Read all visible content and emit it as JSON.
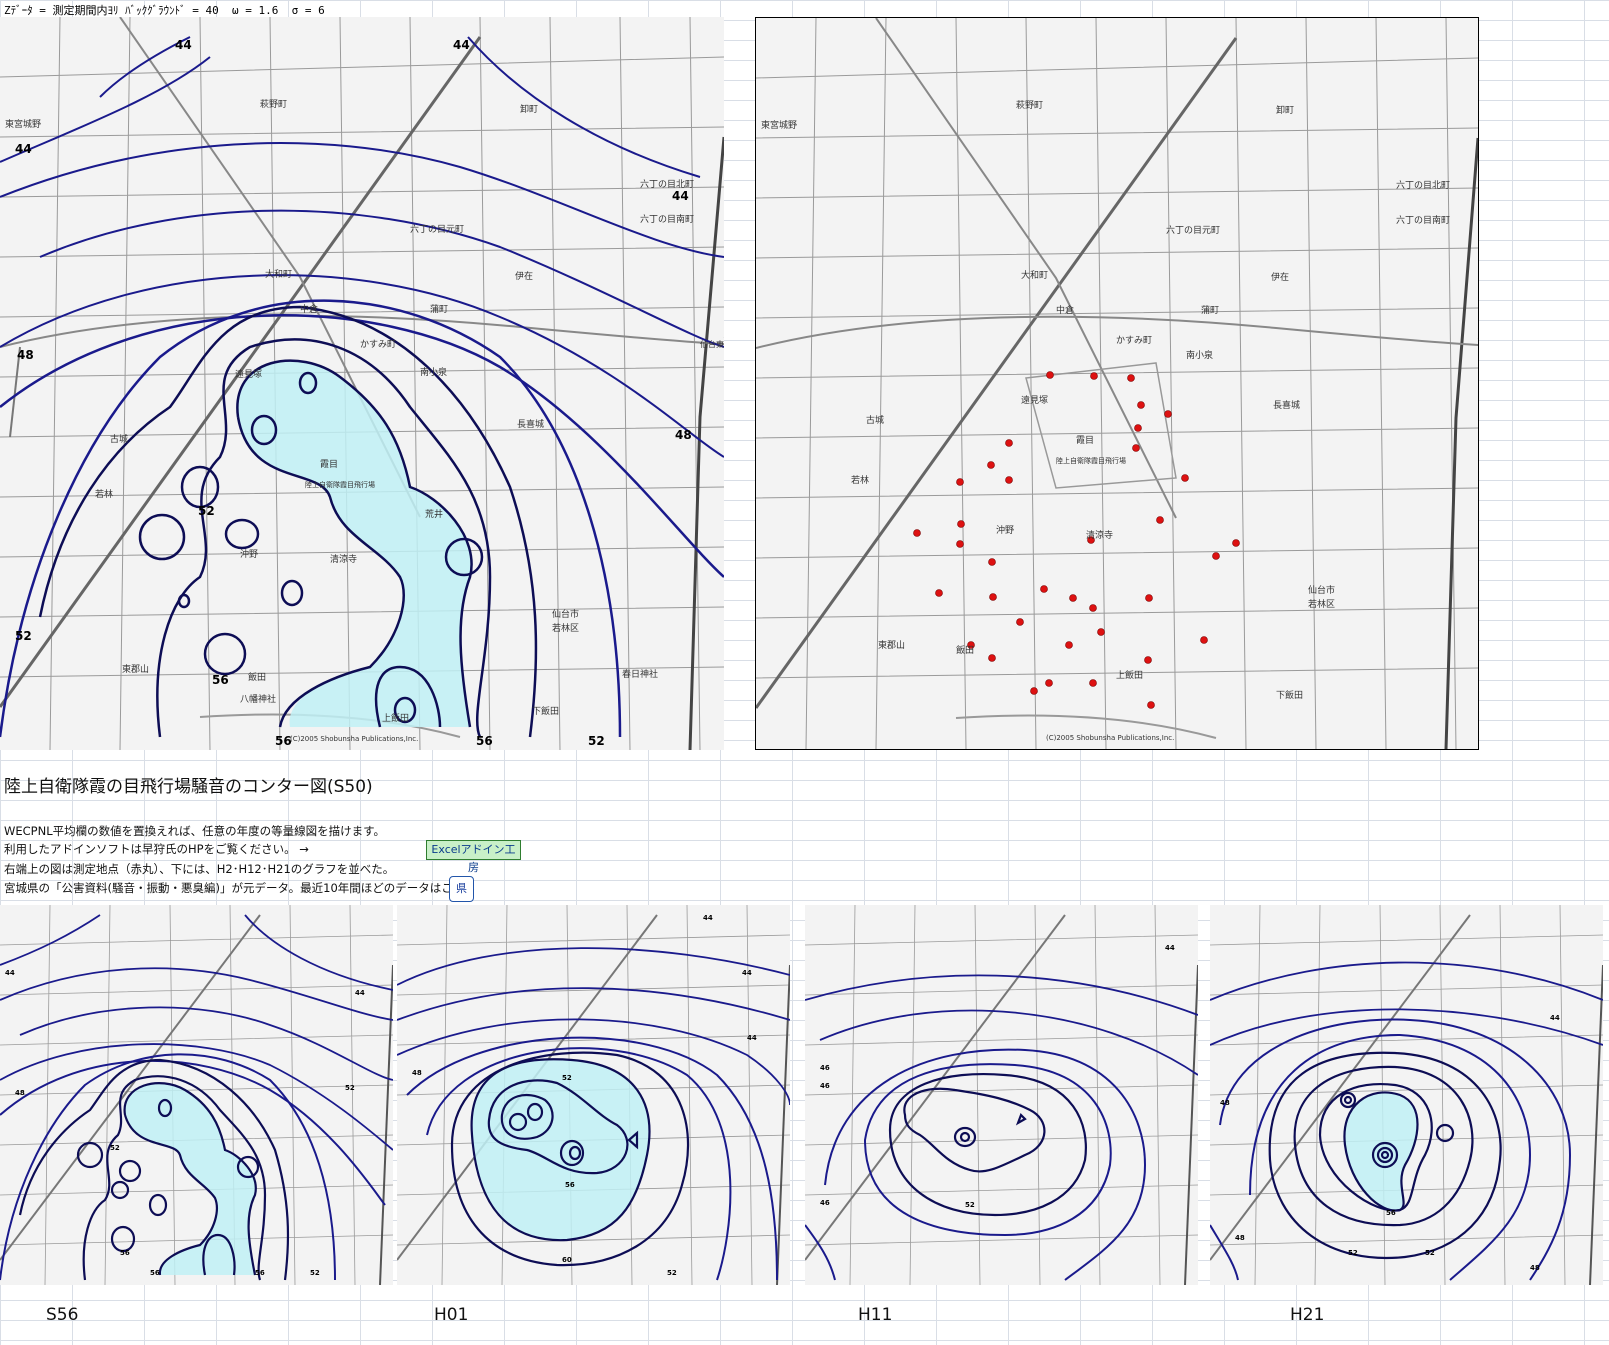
{
  "header": {
    "param_line": "Zﾃﾞｰﾀ = 測定期間内ﾖﾘ ﾊﾞｯｸｸﾞﾗｳﾝﾄﾞ = 40  ω = 1.6  σ = 6"
  },
  "main_map": {
    "contour_labels": [
      "44",
      "44",
      "44",
      "44",
      "48",
      "48",
      "52",
      "52",
      "56",
      "56",
      "56",
      "52"
    ],
    "place_names": [
      "東宮城野",
      "萩野町",
      "卸町",
      "六丁の目北町",
      "六丁の目南町",
      "六丁の目元町",
      "大和町",
      "伊在",
      "中倉",
      "蒲町",
      "南小泉",
      "かすみ町",
      "遠見塚",
      "霞目",
      "長喜城",
      "古城",
      "若林",
      "沖野",
      "荒井",
      "清涼寺",
      "仙台市",
      "若林区",
      "東郡山",
      "飯田",
      "上飯田",
      "下飯田",
      "八幡神社",
      "春日神社",
      "陸上自衛隊霞目飛行場",
      "仙台東部道路",
      "(C)2005 Shobunsha Publications,Inc."
    ]
  },
  "points_map": {
    "place_names": [
      "東宮城野",
      "萩野町",
      "卸町",
      "六丁の目北町",
      "六丁の目南町",
      "六丁の目元町",
      "大和町",
      "伊在",
      "中倉",
      "蒲町",
      "南小泉",
      "かすみ町",
      "遠見塚",
      "霞目",
      "長喜城",
      "古城",
      "若林",
      "沖野",
      "清涼寺",
      "仙台市",
      "若林区",
      "東郡山",
      "飯田",
      "上飯田",
      "下飯田",
      "陸上自衛隊霞目飛行場",
      "(C)2005 Shobunsha Publications,Inc."
    ],
    "marker_color": "#dd1111"
  },
  "title": "陸上自衛隊霞の目飛行場騒音のコンター図(S50)",
  "description": {
    "line1": "WECPNL平均欄の数値を置換えれば、任意の年度の等量線図を描けます。",
    "line2": "利用したアドインソフトは早狩氏のHPをご覧ください。 →",
    "line3": "右端上の図は測定地点（赤丸）、下には、H2･H12･H21のグラフを並べた。",
    "line4": "宮城県の「公害資料(騒音・振動・悪臭編)」が元データ。最近10年間ほどのデータはこちら"
  },
  "buttons": {
    "excel_addin": "Excelアドイン工房",
    "pref": "県"
  },
  "small_maps": [
    {
      "year": "S56",
      "labels": [
        "44",
        "44",
        "48",
        "52",
        "52",
        "56",
        "56",
        "52",
        "56"
      ]
    },
    {
      "year": "H01",
      "labels": [
        "44",
        "44",
        "44",
        "48",
        "52",
        "56",
        "60",
        "52"
      ]
    },
    {
      "year": "H11",
      "labels": [
        "44",
        "46",
        "46",
        "52",
        "46"
      ]
    },
    {
      "year": "H21",
      "labels": [
        "44",
        "48",
        "48",
        "52",
        "56",
        "52",
        "48"
      ]
    }
  ],
  "colors": {
    "contour": "#1a1a8c",
    "contour_dark": "#0d0d55",
    "fill": "#bff0f4",
    "grid": "#d9dee6"
  }
}
